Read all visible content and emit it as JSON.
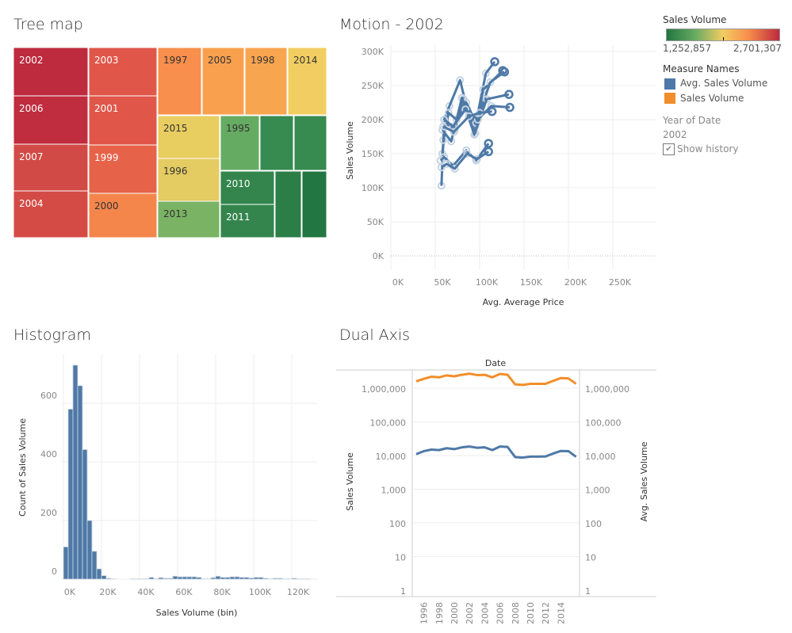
{
  "titles": {
    "treemap": "Tree map",
    "motion": "Motion - 2002",
    "histogram": "Histogram",
    "dual": "Dual Axis"
  },
  "legend": {
    "color_title": "Sales Volume",
    "min": "1,252,857",
    "max": "2,701,307",
    "measure_title": "Measure Names",
    "measures": [
      {
        "name": "Avg. Sales Volume",
        "color": "#4e79a7"
      },
      {
        "name": "Sales Volume",
        "color": "#f28e2b"
      }
    ],
    "year_label": "Year of Date",
    "year_value": "2002",
    "show_history": "Show history",
    "show_history_checked": true
  },
  "chart_data": [
    {
      "type": "treemap",
      "title": "Tree map",
      "tiles": [
        {
          "label": "2002",
          "color": "#be2a3e"
        },
        {
          "label": "2006",
          "color": "#c02d3f"
        },
        {
          "label": "2007",
          "color": "#d24a45"
        },
        {
          "label": "2004",
          "color": "#d44b46"
        },
        {
          "label": "2003",
          "color": "#e0574a"
        },
        {
          "label": "2001",
          "color": "#e0574a"
        },
        {
          "label": "1999",
          "color": "#e6634a"
        },
        {
          "label": "2000",
          "color": "#f4864c"
        },
        {
          "label": "1997",
          "color": "#f88f4c"
        },
        {
          "label": "2005",
          "color": "#f9a04f"
        },
        {
          "label": "1998",
          "color": "#f8a54f"
        },
        {
          "label": "2014",
          "color": "#f2cd62"
        },
        {
          "label": "2015",
          "color": "#e8cd60"
        },
        {
          "label": "1996",
          "color": "#e4cb62"
        },
        {
          "label": "2013",
          "color": "#7ab364"
        },
        {
          "label": "1995",
          "color": "#66ab62"
        },
        {
          "label": "",
          "color": "#378a50"
        },
        {
          "label": "",
          "color": "#378a50"
        },
        {
          "label": "2010",
          "color": "#33854d"
        },
        {
          "label": "2011",
          "color": "#33854d"
        },
        {
          "label": "",
          "color": "#2a7e46"
        },
        {
          "label": "",
          "color": "#227642"
        }
      ]
    },
    {
      "type": "line",
      "title": "Motion - 2002",
      "xlabel": "Avg. Average Price",
      "ylabel": "Sales Volume",
      "xlim": [
        0,
        295000
      ],
      "ylim": [
        -20000,
        305000
      ],
      "xticks": [
        "0K",
        "50K",
        "100K",
        "150K",
        "200K",
        "250K"
      ],
      "yticks": [
        "0K",
        "50K",
        "100K",
        "150K",
        "200K",
        "250K",
        "300K"
      ],
      "color": "#4e79a7",
      "series": [
        [
          [
            57000,
            103000
          ],
          [
            60000,
            200000
          ],
          [
            66000,
            220000
          ],
          [
            78000,
            258000
          ],
          [
            86000,
            215000
          ],
          [
            95000,
            190000
          ],
          [
            107000,
            268000
          ],
          [
            117000,
            285000
          ]
        ],
        [
          [
            58000,
            150000
          ],
          [
            62000,
            195000
          ],
          [
            72000,
            185000
          ],
          [
            82000,
            230000
          ],
          [
            95000,
            180000
          ],
          [
            104000,
            244000
          ],
          [
            126000,
            272000
          ]
        ],
        [
          [
            59000,
            170000
          ],
          [
            65000,
            210000
          ],
          [
            74000,
            200000
          ],
          [
            85000,
            225000
          ],
          [
            96000,
            195000
          ],
          [
            112000,
            255000
          ],
          [
            128000,
            270000
          ]
        ],
        [
          [
            58000,
            185000
          ],
          [
            68000,
            168000
          ],
          [
            80000,
            232000
          ],
          [
            94000,
            178000
          ],
          [
            108000,
            230000
          ],
          [
            133000,
            237000
          ]
        ],
        [
          [
            60000,
            200000
          ],
          [
            70000,
            190000
          ],
          [
            84000,
            215000
          ],
          [
            98000,
            200000
          ],
          [
            113000,
            220000
          ],
          [
            134000,
            218000
          ]
        ],
        [
          [
            59000,
            190000
          ],
          [
            71000,
            182000
          ],
          [
            88000,
            205000
          ],
          [
            100000,
            210000
          ],
          [
            114000,
            212000
          ]
        ],
        [
          [
            56000,
            140000
          ],
          [
            60000,
            145000
          ],
          [
            70000,
            132000
          ],
          [
            85000,
            155000
          ],
          [
            96000,
            140000
          ],
          [
            110000,
            165000
          ]
        ],
        [
          [
            57000,
            130000
          ],
          [
            63000,
            135000
          ],
          [
            72000,
            128000
          ],
          [
            86000,
            150000
          ],
          [
            97000,
            142000
          ],
          [
            110000,
            153000
          ]
        ]
      ]
    },
    {
      "type": "bar",
      "title": "Histogram",
      "xlabel": "Sales Volume (bin)",
      "ylabel": "Count of Sales Volume",
      "bin_width": 2500,
      "xlim": [
        -3000,
        130000
      ],
      "ylim": [
        -30,
        770
      ],
      "xticks": [
        "0K",
        "20K",
        "40K",
        "60K",
        "80K",
        "100K",
        "120K"
      ],
      "yticks": [
        "0",
        "200",
        "400",
        "600"
      ],
      "color": "#4e79a7",
      "values": [
        110,
        580,
        730,
        660,
        442,
        200,
        95,
        35,
        12,
        3,
        1,
        0,
        0,
        0,
        1,
        1,
        1,
        1,
        6,
        1,
        5,
        3,
        3,
        10,
        8,
        8,
        8,
        8,
        6,
        1,
        1,
        5,
        10,
        6,
        6,
        8,
        8,
        6,
        6,
        4,
        6,
        6,
        3,
        1,
        3,
        3,
        1,
        1,
        3,
        1,
        1,
        1
      ]
    },
    {
      "type": "line",
      "title": "Dual Axis",
      "header": "Date",
      "ylabel": "Sales Volume",
      "y2label": "Avg. Sales Volume",
      "yscale": "log",
      "ylim": [
        1,
        5000000
      ],
      "yticks": [
        "1",
        "10",
        "100",
        "1,000",
        "10,000",
        "100,000",
        "1,000,000"
      ],
      "xticks": [
        "1996",
        "1998",
        "2000",
        "2002",
        "2004",
        "2006",
        "2008",
        "2010",
        "2012",
        "2014"
      ],
      "x": [
        1995,
        1996,
        1997,
        1998,
        1999,
        2000,
        2001,
        2002,
        2003,
        2004,
        2005,
        2006,
        2007,
        2008,
        2009,
        2010,
        2011,
        2012,
        2013,
        2014,
        2015,
        2016
      ],
      "series": [
        {
          "name": "Sales Volume",
          "color": "#f28e2b",
          "values": [
            1600000,
            1900000,
            2200000,
            2100000,
            2400000,
            2250000,
            2500000,
            2700000,
            2450000,
            2500000,
            2100000,
            2650000,
            2500000,
            1300000,
            1250000,
            1350000,
            1350000,
            1350000,
            1650000,
            2000000,
            1950000,
            1350000
          ]
        },
        {
          "name": "Avg. Sales Volume",
          "color": "#4e79a7",
          "values": [
            11000,
            13500,
            15000,
            14500,
            16500,
            15500,
            17500,
            18500,
            17000,
            17500,
            14500,
            18500,
            18000,
            9000,
            8700,
            9300,
            9300,
            9400,
            11500,
            13700,
            13500,
            9200
          ]
        }
      ]
    }
  ]
}
